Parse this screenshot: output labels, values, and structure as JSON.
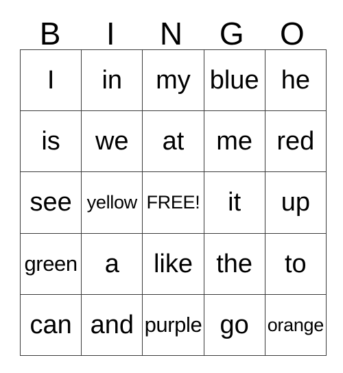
{
  "card": {
    "title": "BINGO",
    "header": {
      "letters": [
        "B",
        "I",
        "N",
        "G",
        "O"
      ]
    },
    "grid": {
      "columns": 5,
      "rows": 5,
      "free_space": "FREE!",
      "free_space_position": {
        "row": 3,
        "column": 3
      },
      "cells": [
        [
          {
            "text": "I",
            "size": "lg"
          },
          {
            "text": "in",
            "size": "lg"
          },
          {
            "text": "my",
            "size": "lg"
          },
          {
            "text": "blue",
            "size": "lg"
          },
          {
            "text": "he",
            "size": "lg"
          }
        ],
        [
          {
            "text": "is",
            "size": "lg"
          },
          {
            "text": "we",
            "size": "lg"
          },
          {
            "text": "at",
            "size": "lg"
          },
          {
            "text": "me",
            "size": "lg"
          },
          {
            "text": "red",
            "size": "lg"
          }
        ],
        [
          {
            "text": "see",
            "size": "lg"
          },
          {
            "text": "yellow",
            "size": "sm"
          },
          {
            "text": "FREE!",
            "size": "sm"
          },
          {
            "text": "it",
            "size": "lg"
          },
          {
            "text": "up",
            "size": "lg"
          }
        ],
        [
          {
            "text": "green",
            "size": "md"
          },
          {
            "text": "a",
            "size": "lg"
          },
          {
            "text": "like",
            "size": "lg"
          },
          {
            "text": "the",
            "size": "lg"
          },
          {
            "text": "to",
            "size": "lg"
          }
        ],
        [
          {
            "text": "can",
            "size": "lg"
          },
          {
            "text": "and",
            "size": "lg"
          },
          {
            "text": "purple",
            "size": "md"
          },
          {
            "text": "go",
            "size": "lg"
          },
          {
            "text": "orange",
            "size": "sm"
          }
        ]
      ]
    },
    "colors": {
      "background": "#ffffff",
      "text": "#000000",
      "border": "#3a3a3a"
    }
  }
}
